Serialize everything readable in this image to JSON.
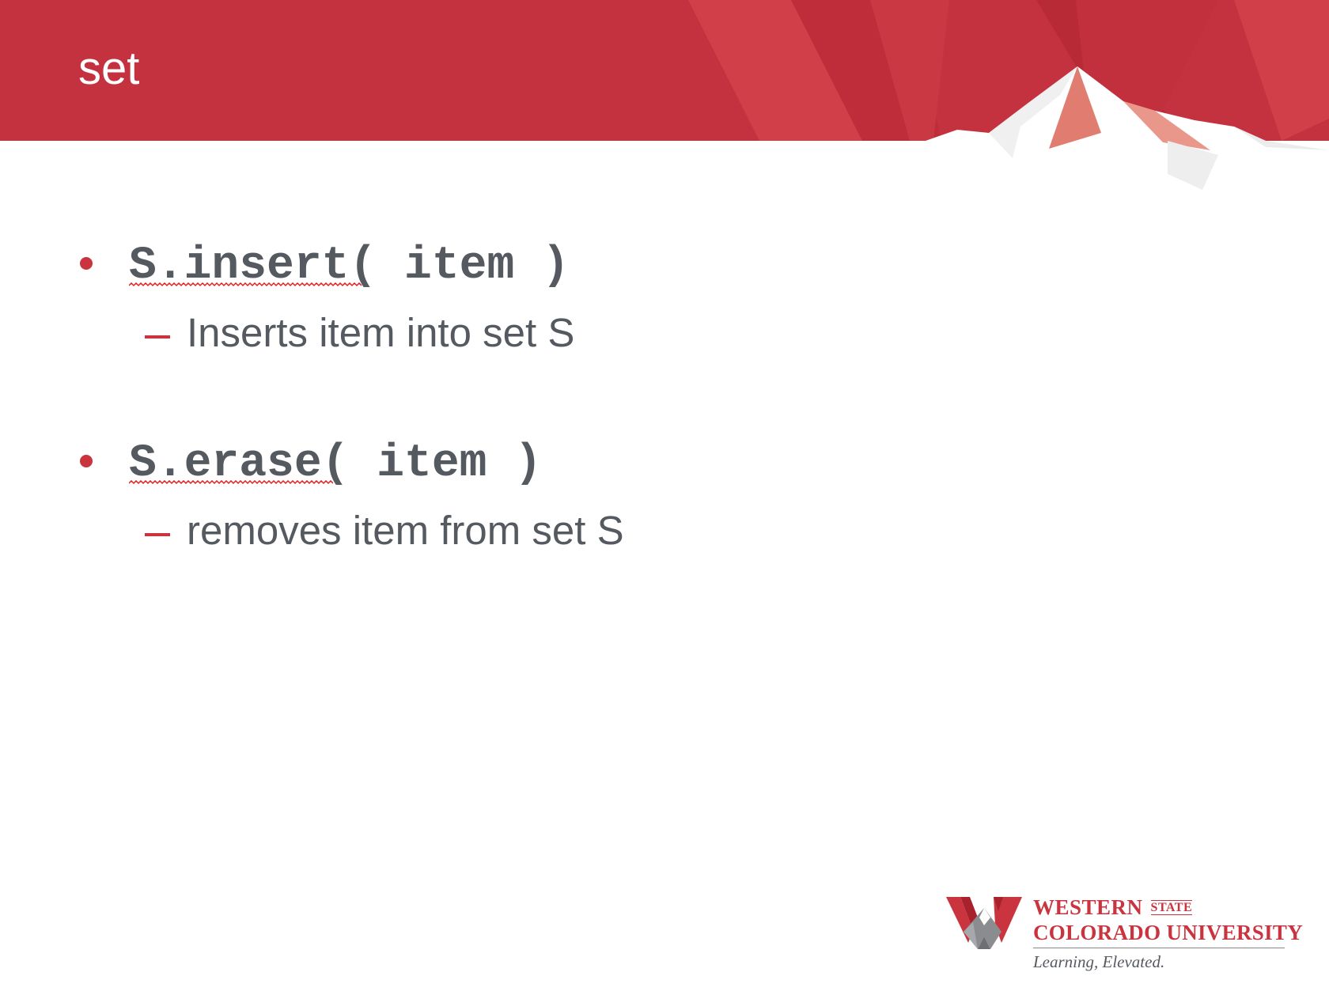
{
  "slide": {
    "title": "set"
  },
  "bullets": [
    {
      "code": "S.insert( item )",
      "description": "Inserts item into set S"
    },
    {
      "code": "S.erase( item )",
      "description": "removes item from set S"
    }
  ],
  "logo": {
    "line1": "Western",
    "line1_small": "STATE",
    "line2": "Colorado University",
    "tagline": "Learning, Elevated."
  },
  "colors": {
    "brand_red": "#c9343f",
    "text_gray": "#555a60"
  }
}
